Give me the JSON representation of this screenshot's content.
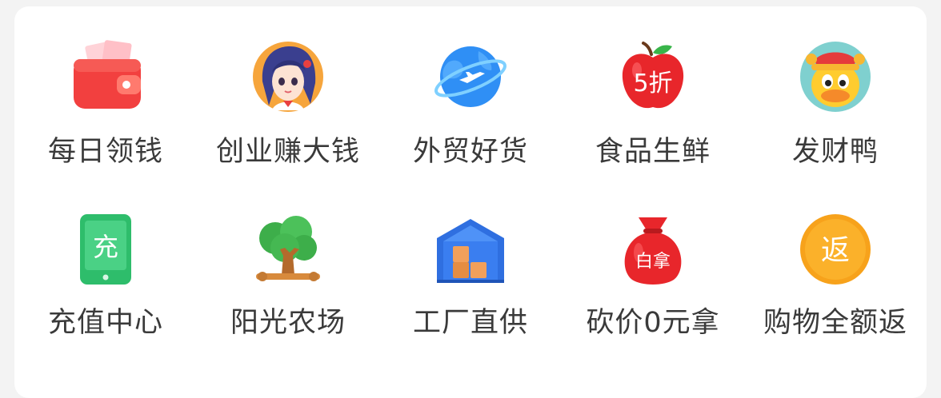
{
  "menu": {
    "items": [
      {
        "label": "每日领钱",
        "icon": "wallet-icon"
      },
      {
        "label": "创业赚大钱",
        "icon": "girl-avatar-icon"
      },
      {
        "label": "外贸好货",
        "icon": "globe-plane-icon"
      },
      {
        "label": "食品生鲜",
        "icon": "apple-discount-icon",
        "badge": "5折"
      },
      {
        "label": "发财鸭",
        "icon": "lucky-duck-icon"
      },
      {
        "label": "充值中心",
        "icon": "recharge-phone-icon",
        "badge": "充"
      },
      {
        "label": "阳光农场",
        "icon": "tree-icon"
      },
      {
        "label": "工厂直供",
        "icon": "warehouse-icon"
      },
      {
        "label": "砍价0元拿",
        "icon": "money-bag-icon",
        "badge": "白拿"
      },
      {
        "label": "购物全额返",
        "icon": "refund-coin-icon",
        "badge": "返"
      }
    ]
  },
  "colors": {
    "red": "#f0383a",
    "blue": "#2f8ff5",
    "green": "#2ebd6b",
    "orange": "#f7a21b",
    "label": "#3a3a3a"
  }
}
